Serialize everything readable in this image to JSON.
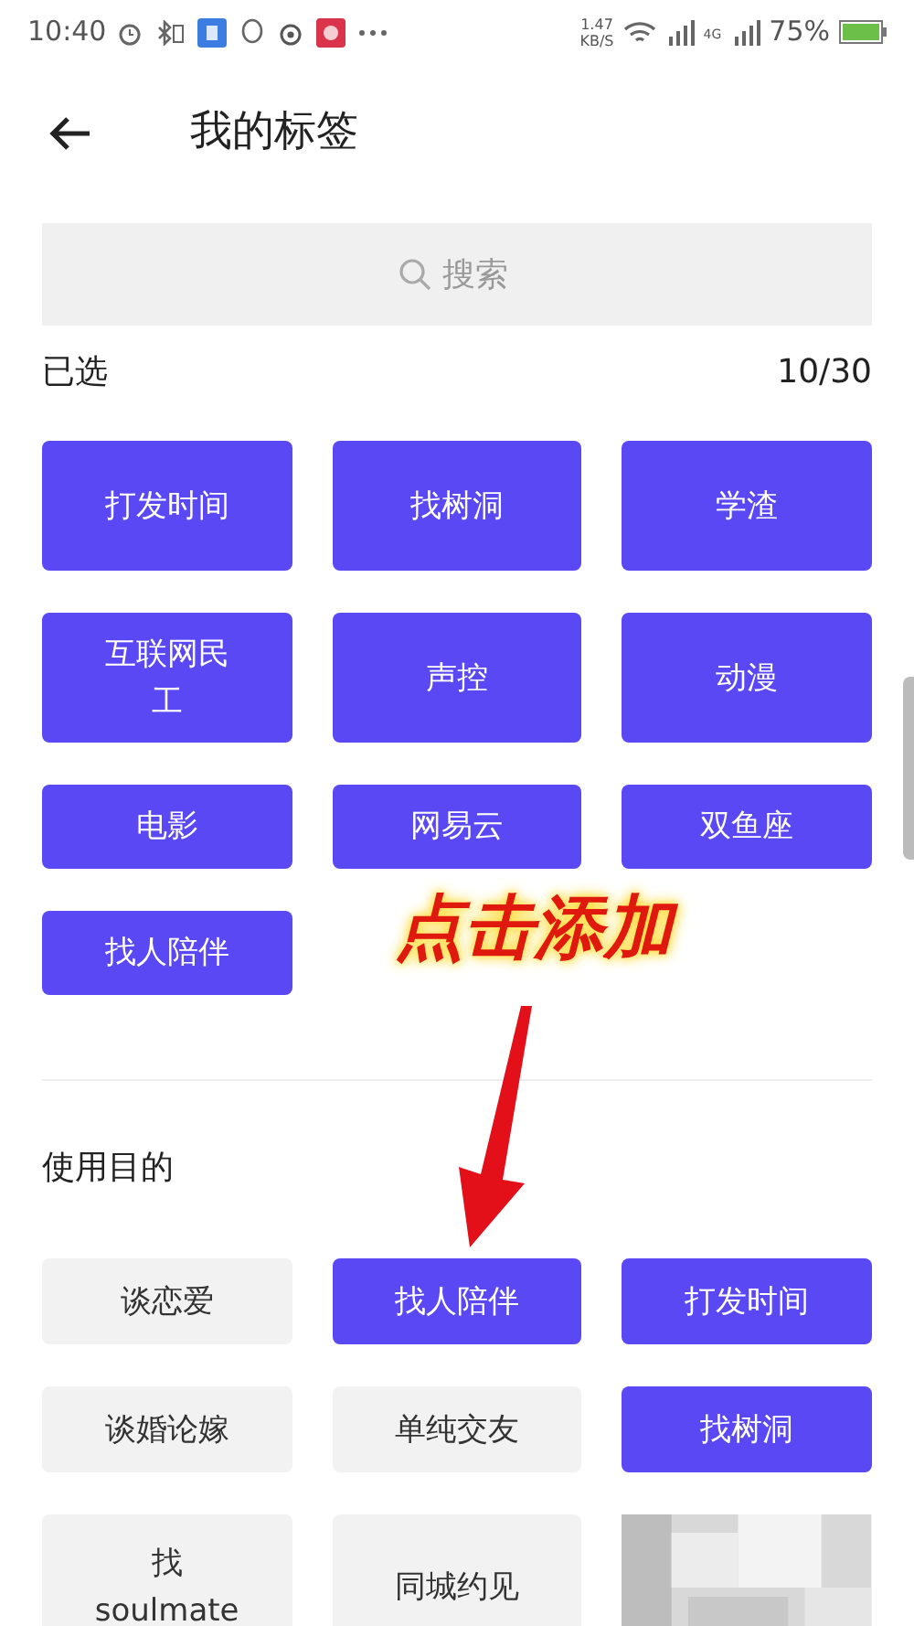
{
  "status_bar": {
    "time": "10:40",
    "speed_value": "1.47",
    "speed_unit": "KB/S",
    "signal_2": "4G",
    "battery": "75%"
  },
  "header": {
    "title": "我的标签"
  },
  "search": {
    "placeholder": "搜索"
  },
  "selected_section": {
    "title": "已选",
    "count": "10/30",
    "tags": [
      {
        "label": "打发时间"
      },
      {
        "label": "找树洞"
      },
      {
        "label": "学渣"
      },
      {
        "label": "互联网民工"
      },
      {
        "label": "声控"
      },
      {
        "label": "动漫"
      },
      {
        "label": "电影"
      },
      {
        "label": "网易云"
      },
      {
        "label": "双鱼座"
      },
      {
        "label": "找人陪伴"
      }
    ]
  },
  "annotation": {
    "text": "点击添加"
  },
  "purpose_section": {
    "title": "使用目的",
    "tags": [
      {
        "label": "谈恋爱",
        "selected": false
      },
      {
        "label": "找人陪伴",
        "selected": true
      },
      {
        "label": "打发时间",
        "selected": true
      },
      {
        "label": "谈婚论嫁",
        "selected": false
      },
      {
        "label": "单纯交友",
        "selected": false
      },
      {
        "label": "找树洞",
        "selected": true
      },
      {
        "label": "找soulmate",
        "selected": false
      },
      {
        "label": "同城约见",
        "selected": false
      }
    ]
  }
}
